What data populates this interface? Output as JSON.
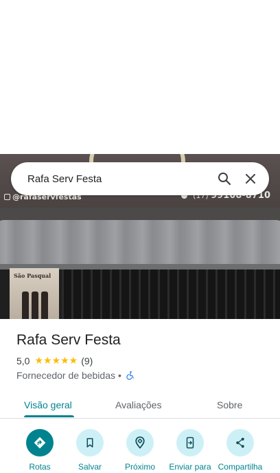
{
  "search": {
    "query": "Rafa Serv Festa"
  },
  "photo_sign": {
    "handle": "@rafaservfestas",
    "phone_prefix": "(17)",
    "phone_number": "99108-8710",
    "poster_text": "São Pasqual"
  },
  "place": {
    "name": "Rafa Serv Festa",
    "rating": "5,0",
    "stars": "★★★★★",
    "review_count": "(9)",
    "category": "Fornecedor de bebidas",
    "separator": "•"
  },
  "tabs": [
    {
      "label": "Visão geral",
      "active": true
    },
    {
      "label": "Avaliações",
      "active": false
    },
    {
      "label": "Sobre",
      "active": false
    }
  ],
  "actions": [
    {
      "label": "Rotas",
      "icon": "directions-icon"
    },
    {
      "label": "Salvar",
      "icon": "bookmark-icon"
    },
    {
      "label": "Próximo",
      "icon": "nearby-icon"
    },
    {
      "label": "Enviar para",
      "icon": "send-to-phone-icon"
    },
    {
      "label": "Compartilha",
      "icon": "share-icon"
    }
  ],
  "colors": {
    "accent": "#00838f",
    "action_bg": "#cdf0f7",
    "star": "#fbbc04"
  }
}
